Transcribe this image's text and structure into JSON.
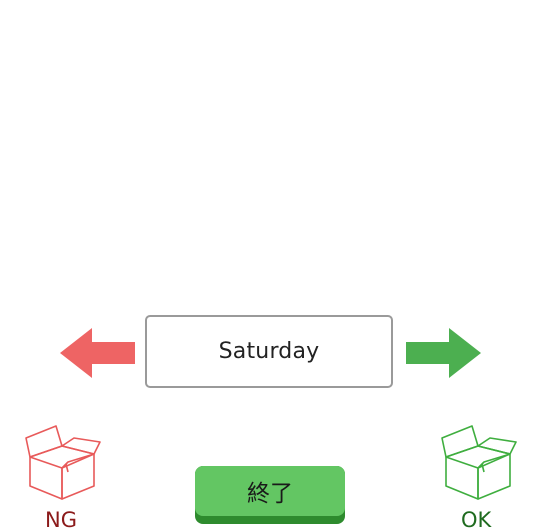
{
  "card": {
    "word": "Saturday"
  },
  "swipe_left": {
    "icon": "left-arrow-icon",
    "color": "#ee6464"
  },
  "swipe_right": {
    "icon": "right-arrow-icon",
    "color": "#4caf50"
  },
  "ng_box": {
    "icon": "open-box-icon",
    "label": "NG",
    "color": "#e85a5a",
    "label_color": "#8b1a1a"
  },
  "ok_box": {
    "icon": "open-box-icon",
    "label": "OK",
    "color": "#3fae3f",
    "label_color": "#1f6b1f"
  },
  "finish_button": {
    "label": "終了",
    "color": "#63c663"
  }
}
